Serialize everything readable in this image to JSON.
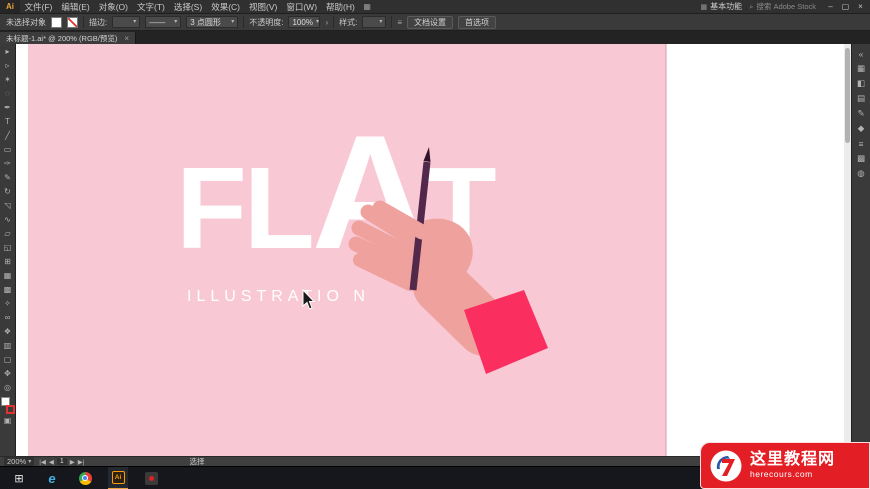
{
  "ui": {
    "caret": "▾",
    "opacity_more": "›"
  },
  "menubar": {
    "logo_text": "Ai",
    "items": [
      {
        "label": "文件(F)"
      },
      {
        "label": "编辑(E)"
      },
      {
        "label": "对象(O)"
      },
      {
        "label": "文字(T)"
      },
      {
        "label": "选择(S)"
      },
      {
        "label": "效果(C)"
      },
      {
        "label": "视图(V)"
      },
      {
        "label": "窗口(W)"
      },
      {
        "label": "帮助(H)"
      }
    ],
    "arrange_icon": "▦",
    "workspace_icon": "▦",
    "workspace_label": "基本功能",
    "search_icon": "⌕",
    "search_text": "搜索 Adobe Stock",
    "window": {
      "minimize": "–",
      "maximize": "▢",
      "close": "×"
    }
  },
  "controlbar": {
    "status": "未选择对象",
    "stroke_label": "描边:",
    "profile_glyph": "——",
    "brush_name": "3 点圆形",
    "opacity_label": "不透明度:",
    "opacity_value": "100%",
    "style_label": "样式:",
    "panel_icon": "≡",
    "document_setup": "文档设置",
    "preferences": "首选项"
  },
  "tabbar": {
    "title": "未标题-1.ai* @ 200% (RGB/预览)",
    "close": "×"
  },
  "toolbar": {
    "tools": [
      {
        "name": "selection-tool-icon",
        "glyph": "▸"
      },
      {
        "name": "direct-selection-tool-icon",
        "glyph": "▹"
      },
      {
        "name": "magic-wand-tool-icon",
        "glyph": "✶"
      },
      {
        "name": "lasso-tool-icon",
        "glyph": "◌"
      },
      {
        "name": "pen-tool-icon",
        "glyph": "✒"
      },
      {
        "name": "type-tool-icon",
        "glyph": "T"
      },
      {
        "name": "line-tool-icon",
        "glyph": "╱"
      },
      {
        "name": "rectangle-tool-icon",
        "glyph": "▭"
      },
      {
        "name": "paintbrush-tool-icon",
        "glyph": "✑"
      },
      {
        "name": "pencil-tool-icon",
        "glyph": "✎"
      },
      {
        "name": "rotate-tool-icon",
        "glyph": "↻"
      },
      {
        "name": "scale-tool-icon",
        "glyph": "◹"
      },
      {
        "name": "width-tool-icon",
        "glyph": "∿"
      },
      {
        "name": "free-transform-tool-icon",
        "glyph": "▱"
      },
      {
        "name": "shape-builder-tool-icon",
        "glyph": "◱"
      },
      {
        "name": "perspective-grid-tool-icon",
        "glyph": "⊞"
      },
      {
        "name": "mesh-tool-icon",
        "glyph": "▦"
      },
      {
        "name": "gradient-tool-icon",
        "glyph": "▩"
      },
      {
        "name": "eyedropper-tool-icon",
        "glyph": "✧"
      },
      {
        "name": "blend-tool-icon",
        "glyph": "∞"
      },
      {
        "name": "symbol-sprayer-tool-icon",
        "glyph": "❖"
      },
      {
        "name": "graph-tool-icon",
        "glyph": "▥"
      },
      {
        "name": "artboard-tool-icon",
        "glyph": "▢"
      },
      {
        "name": "hand-tool-icon",
        "glyph": "✥"
      },
      {
        "name": "zoom-tool-icon",
        "glyph": "◎"
      }
    ],
    "screen_mode_glyph": "▣"
  },
  "rightstrip": {
    "icons": [
      {
        "name": "collapse-panels-icon",
        "glyph": "«"
      },
      {
        "name": "color-panel-icon",
        "glyph": "▦"
      },
      {
        "name": "color-guide-panel-icon",
        "glyph": "◧"
      },
      {
        "name": "swatches-panel-icon",
        "glyph": "▤"
      },
      {
        "name": "brushes-panel-icon",
        "glyph": "✎"
      },
      {
        "name": "symbols-panel-icon",
        "glyph": "◆"
      },
      {
        "name": "stroke-panel-icon",
        "glyph": "≡"
      },
      {
        "name": "gradient-panel-icon",
        "glyph": "▩"
      },
      {
        "name": "transparency-panel-icon",
        "glyph": "◍"
      }
    ]
  },
  "canvas": {
    "headline_parts": [
      "FL",
      "A",
      "T"
    ],
    "subtitle": "ILLUSTRATIO N",
    "colors": {
      "artboard": "#f9c8d5",
      "artboard_edge": "#d89aac",
      "hand": "#efa29d",
      "cuff": "#fa2e5f",
      "pencil": "#53294b",
      "pencil_tip": "#321327",
      "headline": "#ffffff"
    }
  },
  "statusbar": {
    "zoom": "200%",
    "nav": {
      "first": "|◀",
      "prev": "◀",
      "current": "1",
      "next": "▶",
      "last": "▶|"
    },
    "tool": "选择"
  },
  "taskbar": {
    "start_glyph": "⊞",
    "edge_label": "e",
    "illustrator_label": "Ai"
  },
  "watermark": {
    "site_name": "这里教程网",
    "site_url": "herecours.com"
  }
}
